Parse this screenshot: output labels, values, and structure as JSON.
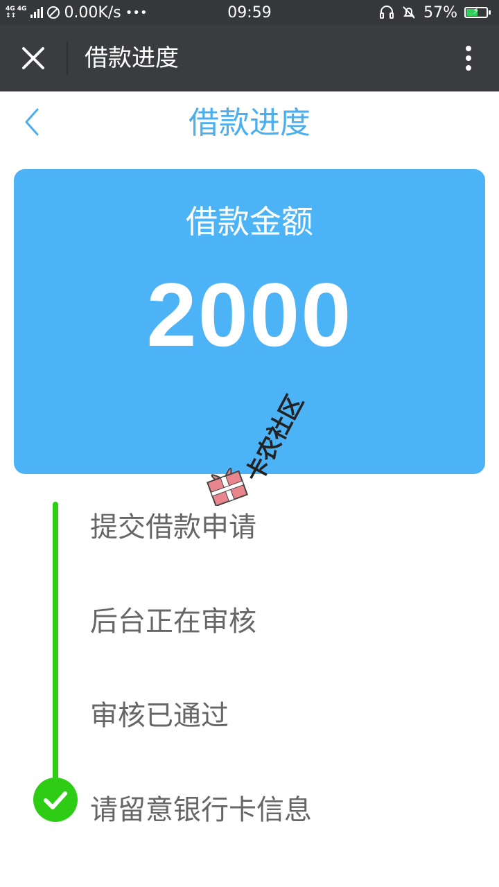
{
  "status_bar": {
    "network_type_top": "4G 4G",
    "network_type_bottom": "↕↕",
    "speed": "0.00K/s",
    "more": "•••",
    "time": "09:59",
    "battery_percent": "57%",
    "battery_level": 0.57,
    "battery_color": "#2fd05a",
    "battery_bolt": "⚡"
  },
  "wx_nav": {
    "title": "借款进度"
  },
  "page": {
    "title": "借款进度"
  },
  "card": {
    "label": "借款金额",
    "amount": "2000",
    "background": "#4db3f7"
  },
  "watermark": {
    "text": "卡农社区"
  },
  "progress": {
    "steps": [
      {
        "label": "提交借款申请"
      },
      {
        "label": "后台正在审核"
      },
      {
        "label": "审核已通过"
      },
      {
        "label": "请留意银行卡信息"
      }
    ],
    "line_color": "#2ecc14"
  }
}
